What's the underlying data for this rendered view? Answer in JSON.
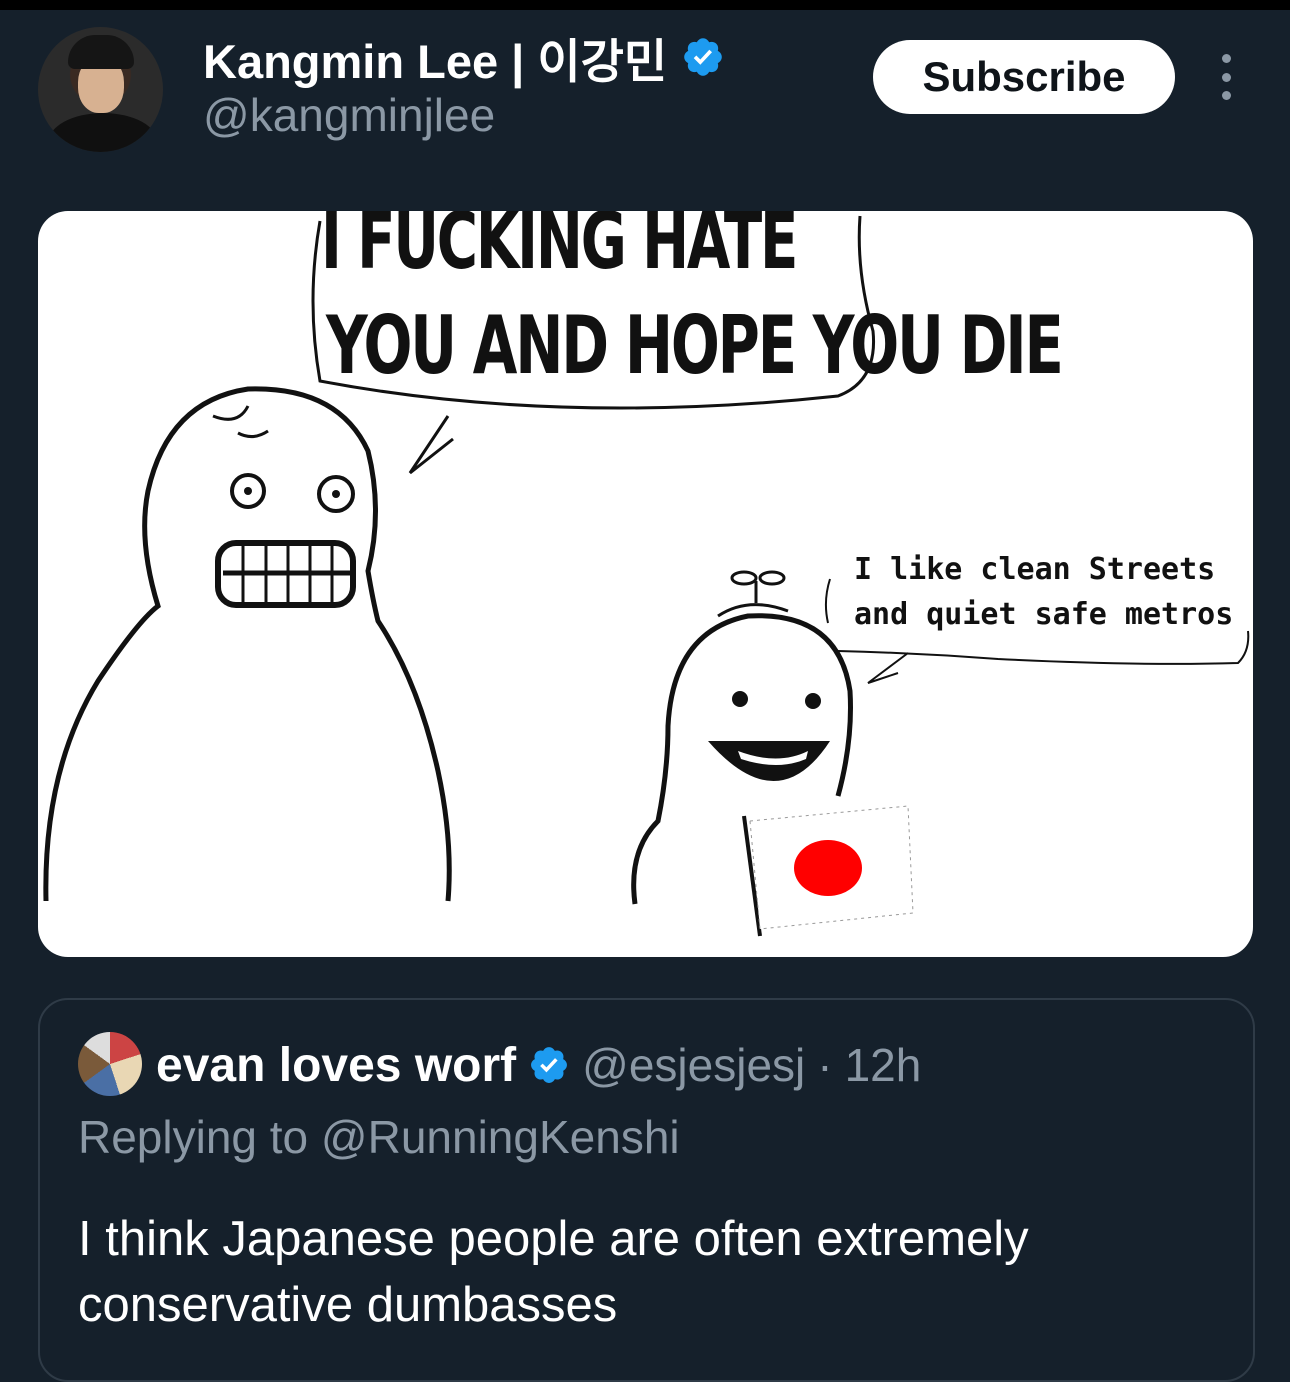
{
  "author": {
    "name": "Kangmin Lee | 이강민",
    "handle": "@kangminjlee",
    "verified_color": "#1d9bf0"
  },
  "actions": {
    "subscribe_label": "Subscribe",
    "more_icon": "vertical-ellipsis-icon"
  },
  "media": {
    "speech_big_line1": "I FUCKING HATE",
    "speech_big_line2": "YOU AND HOPE YOU DIE",
    "speech_small_line1": "I like clean Streets",
    "speech_small_line2": "and quiet safe metros",
    "flag_color": "#ff0000"
  },
  "quoted_tweet": {
    "name": "evan loves worf",
    "handle": "@esjesjesj",
    "time": "12h",
    "replying_to": "Replying to @RunningKenshi",
    "text": "I think Japanese people are often extremely conservative dumbasses"
  }
}
